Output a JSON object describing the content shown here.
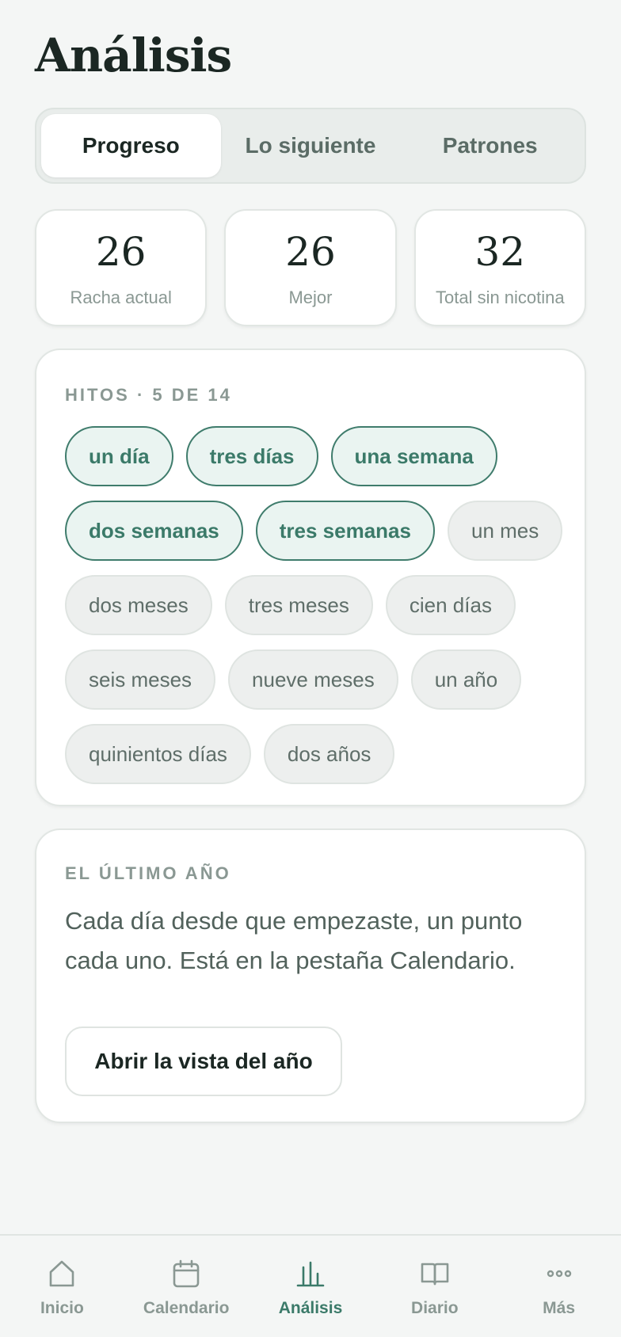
{
  "page": {
    "title": "Análisis"
  },
  "segments": [
    {
      "label": "Progreso",
      "active": true
    },
    {
      "label": "Lo siguiente",
      "active": false
    },
    {
      "label": "Patrones",
      "active": false
    }
  ],
  "stats": [
    {
      "value": "26",
      "label": "Racha actual"
    },
    {
      "value": "26",
      "label": "Mejor"
    },
    {
      "value": "32",
      "label": "Total sin nicotina"
    }
  ],
  "milestones": {
    "heading": "HITOS · 5 DE 14",
    "items": [
      {
        "label": "un día",
        "achieved": true
      },
      {
        "label": "tres días",
        "achieved": true
      },
      {
        "label": "una semana",
        "achieved": true
      },
      {
        "label": "dos semanas",
        "achieved": true
      },
      {
        "label": "tres semanas",
        "achieved": true
      },
      {
        "label": "un mes",
        "achieved": false
      },
      {
        "label": "dos meses",
        "achieved": false
      },
      {
        "label": "tres meses",
        "achieved": false
      },
      {
        "label": "cien días",
        "achieved": false
      },
      {
        "label": "seis meses",
        "achieved": false
      },
      {
        "label": "nueve meses",
        "achieved": false
      },
      {
        "label": "un año",
        "achieved": false
      },
      {
        "label": "quinientos días",
        "achieved": false
      },
      {
        "label": "dos años",
        "achieved": false
      }
    ]
  },
  "year": {
    "heading": "EL ÚLTIMO AÑO",
    "text": "Cada día desde que empezaste, un punto cada uno. Está en la pestaña Calendario.",
    "button_label": "Abrir la vista del año"
  },
  "tabbar": [
    {
      "label": "Inicio",
      "icon": "home-icon",
      "active": false
    },
    {
      "label": "Calendario",
      "icon": "calendar-icon",
      "active": false
    },
    {
      "label": "Análisis",
      "icon": "chart-icon",
      "active": true
    },
    {
      "label": "Diario",
      "icon": "book-icon",
      "active": false
    },
    {
      "label": "Más",
      "icon": "more-icon",
      "active": false
    }
  ],
  "colors": {
    "accent": "#3b7a69",
    "background": "#f4f6f5",
    "muted": "#8a9893"
  }
}
